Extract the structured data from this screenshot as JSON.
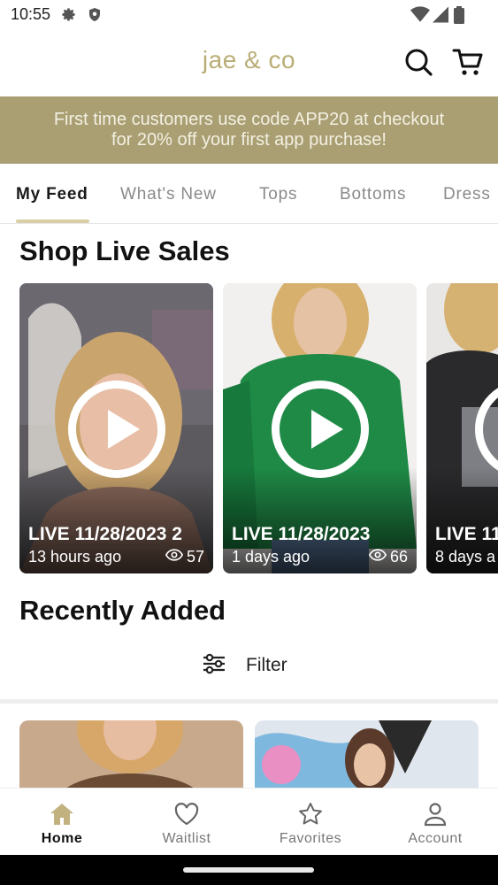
{
  "status_bar": {
    "time": "10:55",
    "icons": [
      "settings-icon",
      "shield-icon",
      "wifi-icon",
      "signal-icon",
      "battery-icon"
    ]
  },
  "header": {
    "brand": "jae & co",
    "brand_color": "#b9ad76",
    "actions": [
      "search-icon",
      "cart-icon"
    ]
  },
  "promo": {
    "line1": "First time customers use code APP20 at checkout",
    "line2": "for 20% off your first app purchase!",
    "background": "#a99f73"
  },
  "tabs": [
    {
      "label": "My Feed",
      "active": true
    },
    {
      "label": "What's New",
      "active": false
    },
    {
      "label": "Tops",
      "active": false
    },
    {
      "label": "Bottoms",
      "active": false
    },
    {
      "label": "Dress",
      "active": false
    }
  ],
  "live_sales": {
    "title": "Shop Live Sales",
    "cards": [
      {
        "title": "LIVE 11/28/2023 2",
        "ago": "13 hours ago",
        "views": "57"
      },
      {
        "title": "LIVE 11/28/2023",
        "ago": "1 days ago",
        "views": "66"
      },
      {
        "title": "LIVE 11",
        "ago": "8 days a",
        "views": ""
      }
    ]
  },
  "recently_added": {
    "title": "Recently Added",
    "filter_label": "Filter"
  },
  "bottom_nav": [
    {
      "label": "Home",
      "icon": "home-icon",
      "active": true
    },
    {
      "label": "Waitlist",
      "icon": "heart-icon",
      "active": false
    },
    {
      "label": "Favorites",
      "icon": "star-icon",
      "active": false
    },
    {
      "label": "Account",
      "icon": "person-icon",
      "active": false
    }
  ],
  "accent_color": "#d9cfa7"
}
